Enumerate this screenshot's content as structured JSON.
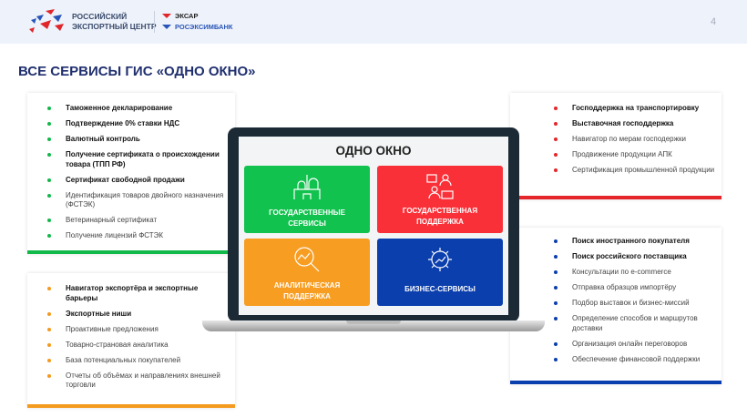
{
  "header": {
    "org_line1": "РОССИЙСКИЙ",
    "org_line2": "ЭКСПОРТНЫЙ ЦЕНТР",
    "partner1": "ЭКСАР",
    "partner2": "РОСЭКСИМБАНК",
    "page_number": "4"
  },
  "title": "ВСЕ СЕРВИСЫ ГИС «ОДНО ОКНО»",
  "colors": {
    "green": "#11b94a",
    "red": "#e5262b",
    "orange": "#f39a1f",
    "blue": "#0b3fae"
  },
  "screen": {
    "title": "ОДНО ОКНО",
    "tiles": [
      {
        "label1": "ГОСУДАРСТВЕННЫЕ",
        "label2": "СЕРВИСЫ",
        "icon": "kremlin-icon"
      },
      {
        "label1": "ГОСУДАРСТВЕННАЯ",
        "label2": "ПОДДЕРЖКА",
        "icon": "consultation-icon"
      },
      {
        "label1": "АНАЛИТИЧЕСКАЯ",
        "label2": "ПОДДЕРЖКА",
        "icon": "magnifier-chart-icon"
      },
      {
        "label1": "БИЗНЕС-СЕРВИСЫ",
        "label2": "",
        "icon": "gear-chart-icon"
      }
    ]
  },
  "gov_services": [
    "Таможенное декларирование",
    "Подтверждение 0% ставки НДС",
    "Валютный контроль",
    "Получение сертификата о происхождении товара (ТПП РФ)",
    "Сертификат свободной продажи",
    "Идентификация товаров двойного назначения (ФСТЭК)",
    "Ветеринарный сертификат",
    "Получение лицензий ФСТЭК"
  ],
  "analytics": [
    "Навигатор экспортёра и экспортные барьеры",
    "Экспортные ниши",
    "Проактивные предложения",
    "Товарно-страновая аналитика",
    "База потенциальных покупателей",
    "Отчеты об объёмах и направлениях внешней торговли"
  ],
  "gov_support": [
    "Господдержка на транспортировку",
    "Выставочная господдержка",
    "Навигатор по мерам господержки",
    "Продвижение продукции АПК",
    "Сертификация промышленной продукции"
  ],
  "business": [
    "Поиск иностранного покупателя",
    "Поиск российского поставщика",
    "Консультации по e-commerce",
    "Отправка образцов импортёру",
    "Подбор выставок и бизнес-миссий",
    "Определение способов и маршрутов доставки",
    "Организация онлайн переговоров",
    "Обеспечение финансовой поддержки"
  ]
}
